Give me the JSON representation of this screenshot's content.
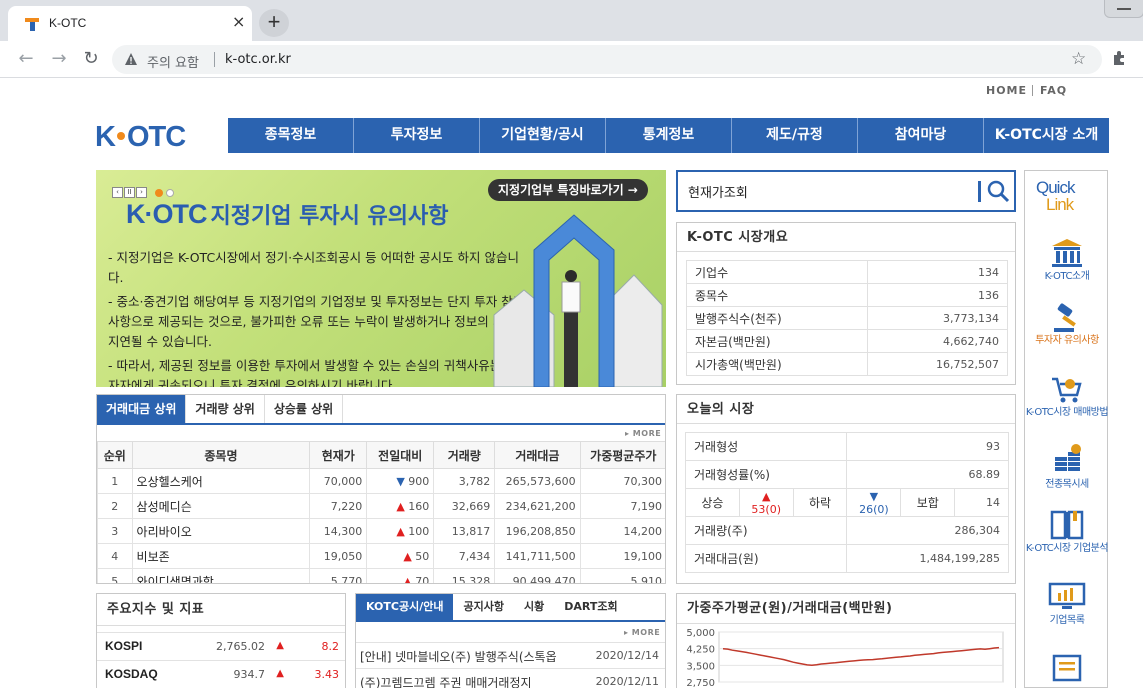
{
  "browser": {
    "tab_title": "K-OTC",
    "tab_close": "×",
    "newtab": "+",
    "security_warning": "주의 요함",
    "url": "k-otc.or.kr"
  },
  "util_links": {
    "home": "HOME",
    "faq": "FAQ"
  },
  "logo": {
    "text": "K·OTC"
  },
  "gnb": [
    "종목정보",
    "투자정보",
    "기업현황/공시",
    "통계정보",
    "제도/규정",
    "참여마당",
    "K-OTC시장 소개"
  ],
  "banner": {
    "paging": [
      "‹",
      "II",
      "›"
    ],
    "shortcut": "지정기업부 특징바로가기 →",
    "logo": "K·OTC",
    "title": "지정기업 투자시 유의사항",
    "notes": [
      "- 지정기업은 K-OTC시장에서 정기·수시조회공시 등 어떠한 공시도 하지 않습니다.",
      "- 중소·중견기업 해당여부 등 지정기업의 기업정보 및 투자정보는 단지 투자 참고사항으로 제공되는 것으로, 불가피한 오류 또는 누락이 발생하거나 정보의 제공이 지연될 수 있습니다.",
      "- 따라서, 제공된 정보를 이용한 투자에서 발생할 수 있는 손실의 귀책사유는 투자자에게 귀속되오니 투자 결정에 유의하시기 바랍니다."
    ]
  },
  "search": {
    "value": "현재가조회"
  },
  "market_overview": {
    "title": "K-OTC 시장개요",
    "rows": [
      {
        "k": "기업수",
        "v": "134"
      },
      {
        "k": "종목수",
        "v": "136"
      },
      {
        "k": "발행주식수(천주)",
        "v": "3,773,134"
      },
      {
        "k": "자본금(백만원)",
        "v": "4,662,740"
      },
      {
        "k": "시가총액(백만원)",
        "v": "16,752,507"
      }
    ]
  },
  "quick": {
    "title1": "Quick",
    "title2": "Link",
    "items": [
      {
        "label": "K-OTC소개",
        "icon": "building-icon"
      },
      {
        "label": "투자자 유의사항",
        "icon": "gavel-icon"
      },
      {
        "label": "K-OTC시장 매매방법",
        "icon": "cart-icon"
      },
      {
        "label": "전종목시세",
        "icon": "coins-icon"
      },
      {
        "label": "K-OTC시장 기업분석",
        "icon": "book-icon"
      },
      {
        "label": "기업목록",
        "icon": "monitor-icon"
      },
      {
        "label": "",
        "icon": "list-icon"
      }
    ]
  },
  "ranking": {
    "tabs": [
      "거래대금 상위",
      "거래량 상위",
      "상승률 상위"
    ],
    "more": "▸ MORE",
    "headers": [
      "순위",
      "종목명",
      "현재가",
      "전일대비",
      "거래량",
      "거래대금",
      "가중평균주가"
    ],
    "rows": [
      {
        "rank": "1",
        "name": "오상헬스케어",
        "price": "70,000",
        "dir": "▼",
        "chg": "900",
        "vol": "3,782",
        "amt": "265,573,600",
        "wavg": "70,300"
      },
      {
        "rank": "2",
        "name": "삼성메디슨",
        "price": "7,220",
        "dir": "▲",
        "chg": "160",
        "vol": "32,669",
        "amt": "234,621,200",
        "wavg": "7,190"
      },
      {
        "rank": "3",
        "name": "아리바이오",
        "price": "14,300",
        "dir": "▲",
        "chg": "100",
        "vol": "13,817",
        "amt": "196,208,850",
        "wavg": "14,200"
      },
      {
        "rank": "4",
        "name": "비보존",
        "price": "19,050",
        "dir": "▲",
        "chg": "50",
        "vol": "7,434",
        "amt": "141,711,500",
        "wavg": "19,100"
      },
      {
        "rank": "5",
        "name": "와이디생명과학",
        "price": "5,770",
        "dir": "▲",
        "chg": "70",
        "vol": "15,328",
        "amt": "90,499,470",
        "wavg": "5,910"
      }
    ]
  },
  "today": {
    "title": "오늘의 시장",
    "deal_count_label": "거래형성",
    "deal_count": "93",
    "deal_rate_label": "거래형성률(%)",
    "deal_rate": "68.89",
    "up_label": "상승",
    "up": "53(0)",
    "down_label": "하락",
    "down": "26(0)",
    "flat_label": "보합",
    "flat": "14",
    "volume_label": "거래량(주)",
    "volume": "286,304",
    "amount_label": "거래대금(원)",
    "amount": "1,484,199,285"
  },
  "indices": {
    "title": "주요지수 및 지표",
    "rows": [
      {
        "name": "KOSPI",
        "val": "2,765.02",
        "arrow": "▲",
        "chg": "8.2"
      },
      {
        "name": "KOSDAQ",
        "val": "934.7",
        "arrow": "▲",
        "chg": "3.43"
      }
    ]
  },
  "notice": {
    "tabs": [
      "KOTC공시/안내",
      "공지사항",
      "시황",
      "DART조회"
    ],
    "more": "▸ MORE",
    "rows": [
      {
        "title": "[안내] 넷마블네오(주) 발행주식(스톡옵",
        "date": "2020/12/14"
      },
      {
        "title": "(주)끄렘드끄렘 주권 매매거래정지",
        "date": "2020/12/11"
      }
    ]
  },
  "chart_data": {
    "type": "line",
    "title": "가중주가평균(원)/거래대금(백만원)",
    "yticks": [
      "5,000",
      "4,250",
      "3,500",
      "2,750"
    ],
    "ylim": [
      2750,
      5000
    ],
    "series": [
      {
        "values": [
          4250,
          4230,
          4180,
          4150,
          4120,
          4080,
          4040,
          4000,
          3960,
          3920,
          3880,
          3840,
          3800,
          3760,
          3700,
          3640,
          3600,
          3560,
          3520,
          3500,
          3530,
          3560,
          3580,
          3600,
          3620,
          3640,
          3660,
          3680,
          3700,
          3720,
          3740,
          3750,
          3760,
          3780,
          3800,
          3820,
          3840,
          3860,
          3880,
          3900,
          3920,
          3950,
          3970,
          3990,
          4010,
          4030,
          4060,
          4080,
          4100,
          4120,
          4140,
          4160,
          4180,
          4200,
          4220,
          4240,
          4220,
          4250,
          4280,
          4300
        ],
        "color": "#c0392b"
      }
    ]
  }
}
